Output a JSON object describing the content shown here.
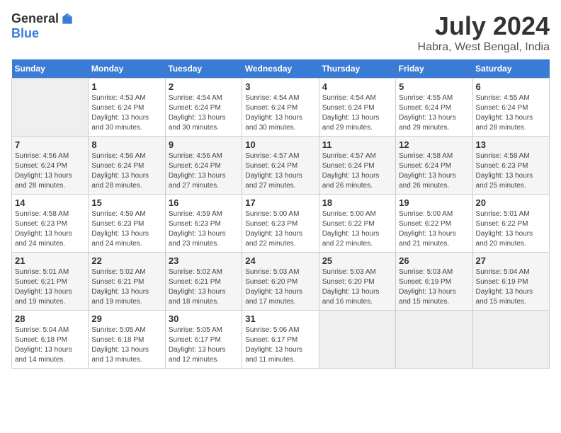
{
  "header": {
    "logo_general": "General",
    "logo_blue": "Blue",
    "title": "July 2024",
    "location": "Habra, West Bengal, India"
  },
  "weekdays": [
    "Sunday",
    "Monday",
    "Tuesday",
    "Wednesday",
    "Thursday",
    "Friday",
    "Saturday"
  ],
  "weeks": [
    [
      {
        "num": "",
        "empty": true
      },
      {
        "num": "1",
        "sunrise": "Sunrise: 4:53 AM",
        "sunset": "Sunset: 6:24 PM",
        "daylight": "Daylight: 13 hours and 30 minutes."
      },
      {
        "num": "2",
        "sunrise": "Sunrise: 4:54 AM",
        "sunset": "Sunset: 6:24 PM",
        "daylight": "Daylight: 13 hours and 30 minutes."
      },
      {
        "num": "3",
        "sunrise": "Sunrise: 4:54 AM",
        "sunset": "Sunset: 6:24 PM",
        "daylight": "Daylight: 13 hours and 30 minutes."
      },
      {
        "num": "4",
        "sunrise": "Sunrise: 4:54 AM",
        "sunset": "Sunset: 6:24 PM",
        "daylight": "Daylight: 13 hours and 29 minutes."
      },
      {
        "num": "5",
        "sunrise": "Sunrise: 4:55 AM",
        "sunset": "Sunset: 6:24 PM",
        "daylight": "Daylight: 13 hours and 29 minutes."
      },
      {
        "num": "6",
        "sunrise": "Sunrise: 4:55 AM",
        "sunset": "Sunset: 6:24 PM",
        "daylight": "Daylight: 13 hours and 28 minutes."
      }
    ],
    [
      {
        "num": "7",
        "sunrise": "Sunrise: 4:56 AM",
        "sunset": "Sunset: 6:24 PM",
        "daylight": "Daylight: 13 hours and 28 minutes."
      },
      {
        "num": "8",
        "sunrise": "Sunrise: 4:56 AM",
        "sunset": "Sunset: 6:24 PM",
        "daylight": "Daylight: 13 hours and 28 minutes."
      },
      {
        "num": "9",
        "sunrise": "Sunrise: 4:56 AM",
        "sunset": "Sunset: 6:24 PM",
        "daylight": "Daylight: 13 hours and 27 minutes."
      },
      {
        "num": "10",
        "sunrise": "Sunrise: 4:57 AM",
        "sunset": "Sunset: 6:24 PM",
        "daylight": "Daylight: 13 hours and 27 minutes."
      },
      {
        "num": "11",
        "sunrise": "Sunrise: 4:57 AM",
        "sunset": "Sunset: 6:24 PM",
        "daylight": "Daylight: 13 hours and 26 minutes."
      },
      {
        "num": "12",
        "sunrise": "Sunrise: 4:58 AM",
        "sunset": "Sunset: 6:24 PM",
        "daylight": "Daylight: 13 hours and 26 minutes."
      },
      {
        "num": "13",
        "sunrise": "Sunrise: 4:58 AM",
        "sunset": "Sunset: 6:23 PM",
        "daylight": "Daylight: 13 hours and 25 minutes."
      }
    ],
    [
      {
        "num": "14",
        "sunrise": "Sunrise: 4:58 AM",
        "sunset": "Sunset: 6:23 PM",
        "daylight": "Daylight: 13 hours and 24 minutes."
      },
      {
        "num": "15",
        "sunrise": "Sunrise: 4:59 AM",
        "sunset": "Sunset: 6:23 PM",
        "daylight": "Daylight: 13 hours and 24 minutes."
      },
      {
        "num": "16",
        "sunrise": "Sunrise: 4:59 AM",
        "sunset": "Sunset: 6:23 PM",
        "daylight": "Daylight: 13 hours and 23 minutes."
      },
      {
        "num": "17",
        "sunrise": "Sunrise: 5:00 AM",
        "sunset": "Sunset: 6:23 PM",
        "daylight": "Daylight: 13 hours and 22 minutes."
      },
      {
        "num": "18",
        "sunrise": "Sunrise: 5:00 AM",
        "sunset": "Sunset: 6:22 PM",
        "daylight": "Daylight: 13 hours and 22 minutes."
      },
      {
        "num": "19",
        "sunrise": "Sunrise: 5:00 AM",
        "sunset": "Sunset: 6:22 PM",
        "daylight": "Daylight: 13 hours and 21 minutes."
      },
      {
        "num": "20",
        "sunrise": "Sunrise: 5:01 AM",
        "sunset": "Sunset: 6:22 PM",
        "daylight": "Daylight: 13 hours and 20 minutes."
      }
    ],
    [
      {
        "num": "21",
        "sunrise": "Sunrise: 5:01 AM",
        "sunset": "Sunset: 6:21 PM",
        "daylight": "Daylight: 13 hours and 19 minutes."
      },
      {
        "num": "22",
        "sunrise": "Sunrise: 5:02 AM",
        "sunset": "Sunset: 6:21 PM",
        "daylight": "Daylight: 13 hours and 19 minutes."
      },
      {
        "num": "23",
        "sunrise": "Sunrise: 5:02 AM",
        "sunset": "Sunset: 6:21 PM",
        "daylight": "Daylight: 13 hours and 18 minutes."
      },
      {
        "num": "24",
        "sunrise": "Sunrise: 5:03 AM",
        "sunset": "Sunset: 6:20 PM",
        "daylight": "Daylight: 13 hours and 17 minutes."
      },
      {
        "num": "25",
        "sunrise": "Sunrise: 5:03 AM",
        "sunset": "Sunset: 6:20 PM",
        "daylight": "Daylight: 13 hours and 16 minutes."
      },
      {
        "num": "26",
        "sunrise": "Sunrise: 5:03 AM",
        "sunset": "Sunset: 6:19 PM",
        "daylight": "Daylight: 13 hours and 15 minutes."
      },
      {
        "num": "27",
        "sunrise": "Sunrise: 5:04 AM",
        "sunset": "Sunset: 6:19 PM",
        "daylight": "Daylight: 13 hours and 15 minutes."
      }
    ],
    [
      {
        "num": "28",
        "sunrise": "Sunrise: 5:04 AM",
        "sunset": "Sunset: 6:18 PM",
        "daylight": "Daylight: 13 hours and 14 minutes."
      },
      {
        "num": "29",
        "sunrise": "Sunrise: 5:05 AM",
        "sunset": "Sunset: 6:18 PM",
        "daylight": "Daylight: 13 hours and 13 minutes."
      },
      {
        "num": "30",
        "sunrise": "Sunrise: 5:05 AM",
        "sunset": "Sunset: 6:17 PM",
        "daylight": "Daylight: 13 hours and 12 minutes."
      },
      {
        "num": "31",
        "sunrise": "Sunrise: 5:06 AM",
        "sunset": "Sunset: 6:17 PM",
        "daylight": "Daylight: 13 hours and 11 minutes."
      },
      {
        "num": "",
        "empty": true
      },
      {
        "num": "",
        "empty": true
      },
      {
        "num": "",
        "empty": true
      }
    ]
  ]
}
